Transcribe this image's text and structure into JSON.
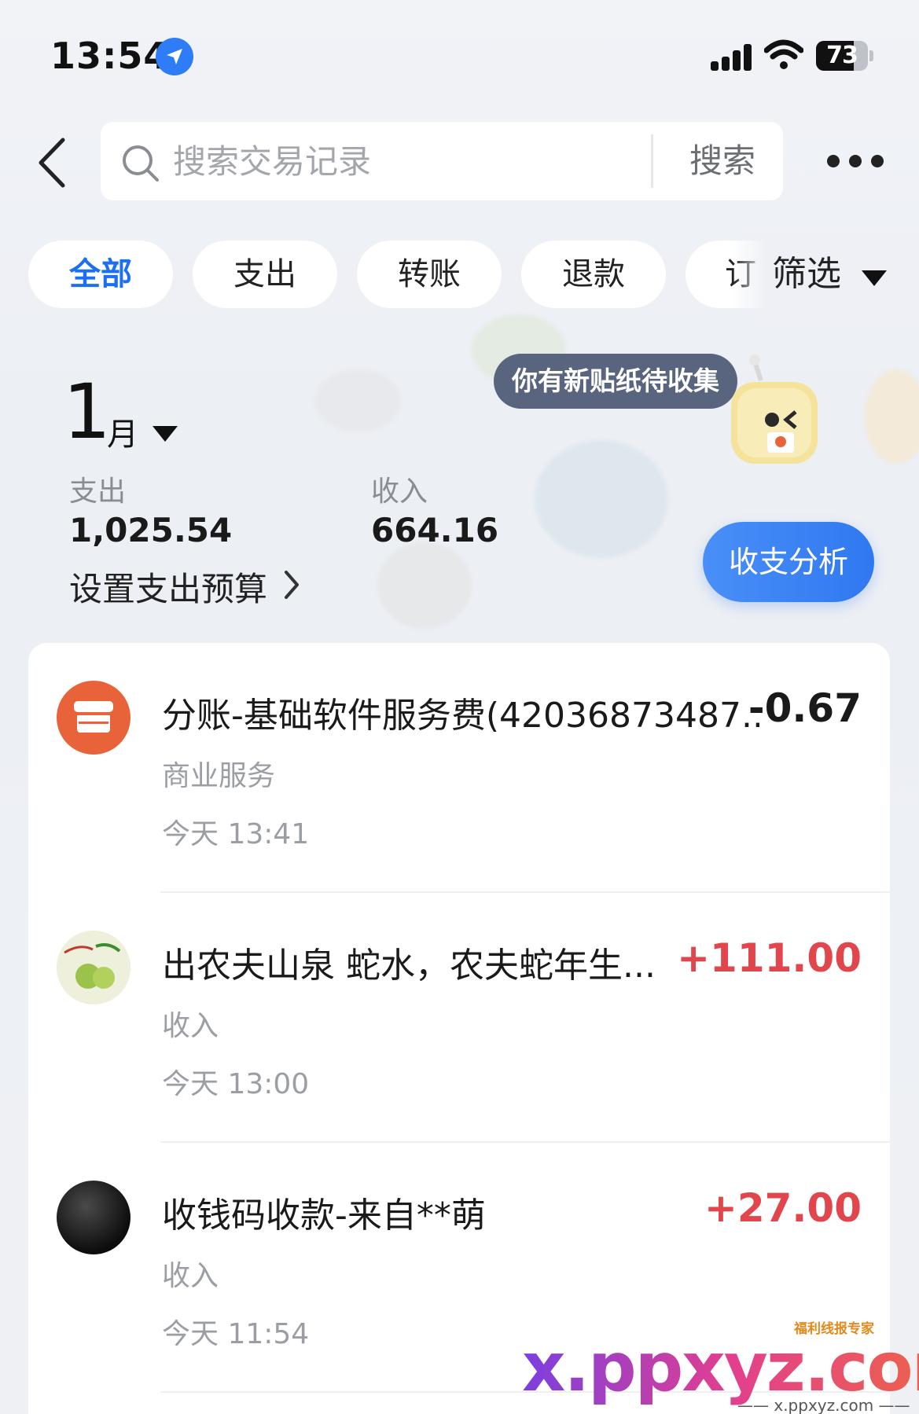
{
  "status_bar": {
    "time": "13:54",
    "battery_level": "73",
    "battery_fraction": 0.73
  },
  "search": {
    "placeholder": "搜索交易记录",
    "button_label": "搜索"
  },
  "chips": [
    {
      "label": "全部",
      "active": true
    },
    {
      "label": "支出",
      "active": false
    },
    {
      "label": "转账",
      "active": false
    },
    {
      "label": "退款",
      "active": false
    },
    {
      "label": "订",
      "active": false
    }
  ],
  "filter_label": "筛选",
  "summary": {
    "month_number": "1",
    "month_unit": "月",
    "expense_label": "支出",
    "expense_value": "1,025.54",
    "income_label": "收入",
    "income_value": "664.16",
    "budget_link": "设置支出预算",
    "analysis_button": "收支分析"
  },
  "sticker_bubble": "你有新贴纸待收集",
  "transactions": [
    {
      "title": "分账-基础软件服务费(42036873487...",
      "amount": "-0.67",
      "category": "商业服务",
      "time": "今天 13:41",
      "avatar_icon": "store-icon"
    },
    {
      "title": "出农夫山泉 蛇水，农夫蛇年生...",
      "amount": "+111.00",
      "category": "收入",
      "time": "今天 13:00",
      "avatar_icon": "green-apple-avatar"
    },
    {
      "title": "收钱码收款-来自**萌",
      "amount": "+27.00",
      "category": "收入",
      "time": "今天 11:54",
      "avatar_icon": "black-circle-avatar"
    }
  ],
  "watermark": {
    "main": "x.ppxyz.com",
    "tag": "福利线报专家",
    "sub": "—— x.ppxyz.com ——"
  },
  "colors": {
    "accent_blue": "#1c6ff2",
    "positive_red": "#e0464b",
    "store_orange": "#e8623a"
  }
}
